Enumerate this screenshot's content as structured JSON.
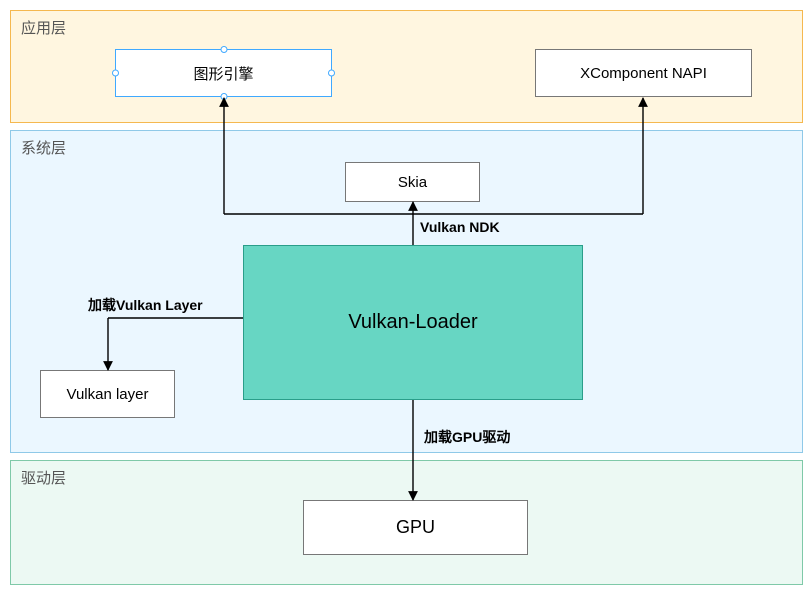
{
  "layers": {
    "app": {
      "title": "应用层"
    },
    "system": {
      "title": "系统层"
    },
    "driver": {
      "title": "驱动层"
    }
  },
  "nodes": {
    "engine": {
      "label": "图形引擎"
    },
    "xcomponent": {
      "label": "XComponent NAPI"
    },
    "skia": {
      "label": "Skia"
    },
    "vloader": {
      "label": "Vulkan-Loader"
    },
    "vlayer": {
      "label": "Vulkan layer"
    },
    "gpu": {
      "label": "GPU"
    }
  },
  "edges": {
    "vulkan_ndk": {
      "label": "Vulkan NDK"
    },
    "load_layer": {
      "label": "加载Vulkan Layer"
    },
    "load_driver": {
      "label": "加载GPU驱动"
    }
  }
}
